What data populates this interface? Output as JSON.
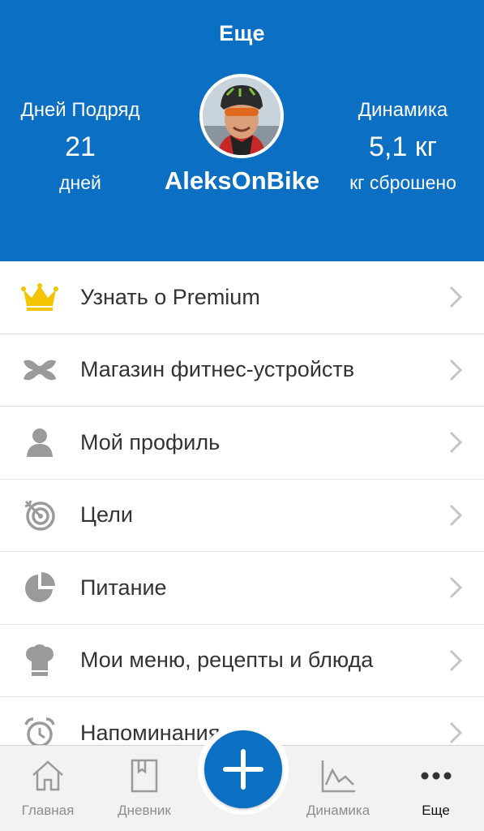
{
  "header": {
    "title": "Еще",
    "streak": {
      "label": "Дней Подряд",
      "value": "21",
      "unit": "дней"
    },
    "progress": {
      "label": "Динамика",
      "value": "5,1 кг",
      "unit": "кг сброшено"
    },
    "username": "AleksOnBike"
  },
  "menu": {
    "items": [
      {
        "label": "Узнать о Premium",
        "icon": "crown-icon",
        "icon_color": "#f5c400"
      },
      {
        "label": "Магазин фитнес-устройств",
        "icon": "under-armour-logo-icon",
        "icon_color": "#9a9a9a"
      },
      {
        "label": "Мой профиль",
        "icon": "person-icon",
        "icon_color": "#9a9a9a"
      },
      {
        "label": "Цели",
        "icon": "target-icon",
        "icon_color": "#9a9a9a"
      },
      {
        "label": "Питание",
        "icon": "pie-chart-icon",
        "icon_color": "#9a9a9a"
      },
      {
        "label": "Мои меню, рецепты и блюда",
        "icon": "chef-hat-icon",
        "icon_color": "#9a9a9a"
      },
      {
        "label": "Напоминания",
        "icon": "alarm-clock-icon",
        "icon_color": "#9a9a9a"
      }
    ]
  },
  "tabbar": {
    "tabs": [
      {
        "label": "Главная",
        "icon": "home-icon"
      },
      {
        "label": "Дневник",
        "icon": "diary-icon"
      },
      {
        "label": "",
        "icon": "plus-icon"
      },
      {
        "label": "Динамика",
        "icon": "chart-icon"
      },
      {
        "label": "Еще",
        "icon": "more-dots-icon",
        "active": true
      }
    ]
  },
  "colors": {
    "brand_blue": "#0b6fc4",
    "premium_gold": "#f5c400",
    "icon_grey": "#9a9a9a"
  }
}
